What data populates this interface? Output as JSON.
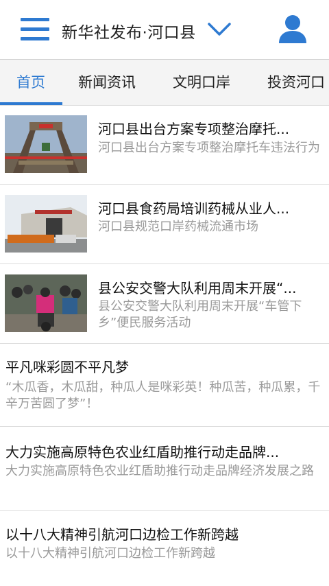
{
  "header": {
    "title": "新华社发布·河口县",
    "menu_icon": "hamburger-menu-icon",
    "dropdown_icon": "chevron-down-icon",
    "user_icon": "user-profile-icon"
  },
  "colors": {
    "accent": "#2e7ad1",
    "title_text": "#111111",
    "summary_text": "#9a9a9a",
    "tab_bar_bg": "#f4f4f4"
  },
  "tabs": [
    {
      "label": "首页",
      "active": true
    },
    {
      "label": "新闻资讯",
      "active": false
    },
    {
      "label": "文明口岸",
      "active": false
    },
    {
      "label": "投资河口",
      "active": false
    }
  ],
  "news": [
    {
      "title": "河口县出台方案专项整治摩托...",
      "summary": "河口县出台方案专项整治摩托车违法行为",
      "has_image": true
    },
    {
      "title": "河口县食药局培训药械从业人...",
      "summary": "河口县规范口岸药械流通市场",
      "has_image": true
    },
    {
      "title": "县公安交警大队利用周末开展“...",
      "summary": "县公安交警大队利用周末开展“车管下乡”便民服务活动",
      "has_image": true
    },
    {
      "title": "平凡咪彩圆不平凡梦",
      "summary": "“木瓜香，木瓜甜，种瓜人是咪彩英！种瓜苦，种瓜累，千辛万苦圆了梦”！",
      "has_image": false
    },
    {
      "title": "大力实施高原特色农业红盾助推行动走品牌...",
      "summary": "大力实施高原特色农业红盾助推行动走品牌经济发展之路",
      "has_image": false
    },
    {
      "title": "以十八大精神引航河口边检工作新跨越",
      "summary": "以十八大精神引航河口边检工作新跨越",
      "has_image": false
    }
  ]
}
